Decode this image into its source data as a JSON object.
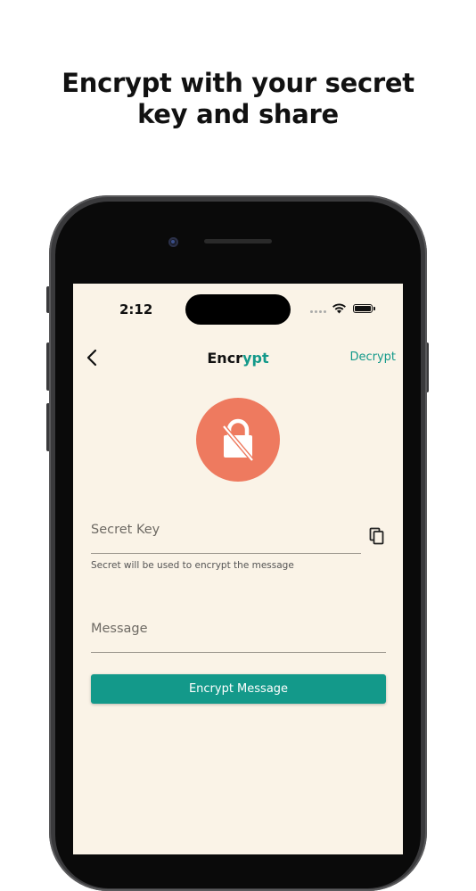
{
  "headline": {
    "line1": "Encrypt with your secret",
    "line2": "key and share"
  },
  "status_bar": {
    "time": "2:12"
  },
  "nav": {
    "title_part1": "Encr",
    "title_part2": "ypt",
    "action_label": "Decrypt"
  },
  "form": {
    "secret_key_placeholder": "Secret Key",
    "secret_key_value": "",
    "secret_key_helper": "Secret will be used to encrypt the message",
    "message_placeholder": "Message",
    "message_value": "",
    "submit_label": "Encrypt Message"
  },
  "icons": {
    "back": "chevron-left-icon",
    "lock": "lock-off-icon",
    "copy": "copy-icon",
    "wifi": "wifi-icon",
    "battery": "battery-icon"
  },
  "colors": {
    "accent": "#13998a",
    "lock_circle": "#ee7a5f",
    "screen_background": "#faf3e7"
  }
}
